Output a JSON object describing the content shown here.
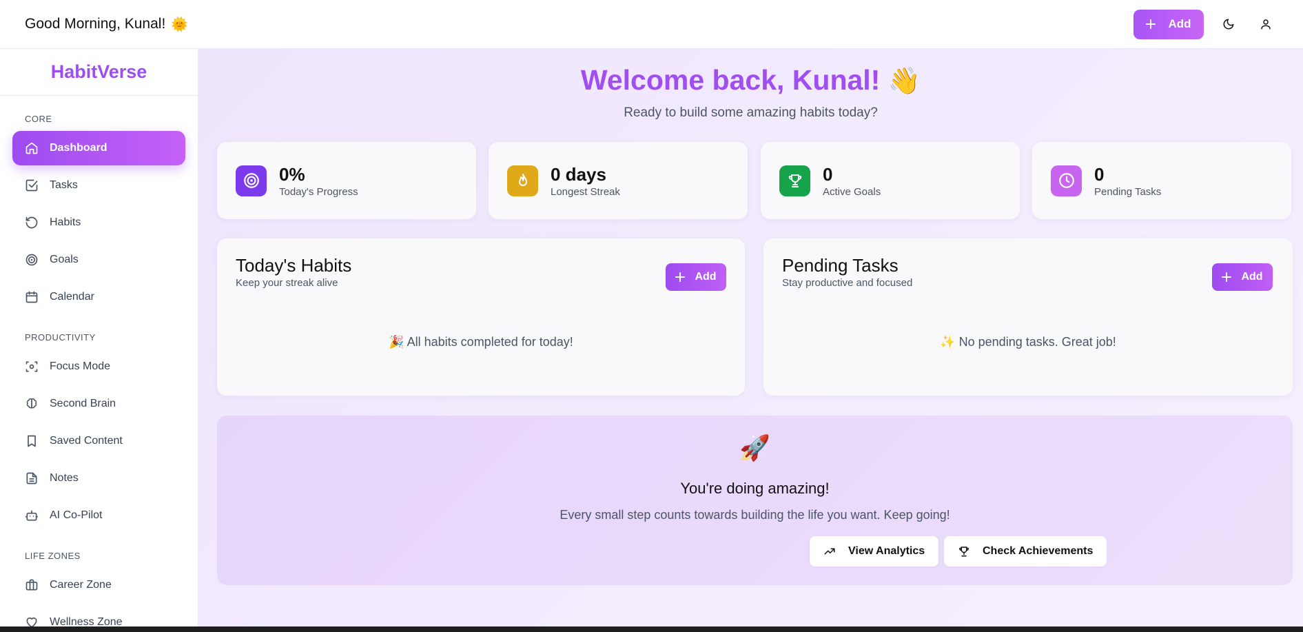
{
  "topbar": {
    "greeting": "Good Morning, Kunal!",
    "greeting_emoji": "🌞",
    "add_label": "Add",
    "theme_icon": "moon-icon",
    "profile_icon": "user-icon"
  },
  "sidebar": {
    "brand": "HabitVerse",
    "sections": {
      "core": "CORE",
      "productivity": "PRODUCTIVITY",
      "life_zones": "LIFE ZONES"
    },
    "core_items": [
      {
        "label": "Dashboard",
        "icon": "home-icon",
        "active": true
      },
      {
        "label": "Tasks",
        "icon": "checkbox-icon"
      },
      {
        "label": "Habits",
        "icon": "refresh-icon"
      },
      {
        "label": "Goals",
        "icon": "target-icon"
      },
      {
        "label": "Calendar",
        "icon": "calendar-icon"
      }
    ],
    "productivity_items": [
      {
        "label": "Focus Mode",
        "icon": "focus-icon"
      },
      {
        "label": "Second Brain",
        "icon": "brain-icon"
      },
      {
        "label": "Saved Content",
        "icon": "bookmark-icon"
      },
      {
        "label": "Notes",
        "icon": "file-text-icon"
      },
      {
        "label": "AI Co-Pilot",
        "icon": "bot-icon"
      }
    ],
    "life_zone_items": [
      {
        "label": "Career Zone",
        "icon": "briefcase-icon"
      },
      {
        "label": "Wellness Zone",
        "icon": "heart-icon"
      }
    ]
  },
  "main": {
    "welcome": "Welcome back, Kunal!",
    "welcome_emoji": "👋",
    "subtitle": "Ready to build some amazing habits today?",
    "stats": [
      {
        "value": "0%",
        "label": "Today's Progress",
        "icon": "target-icon",
        "color": "#7c3aed"
      },
      {
        "value": "0 days",
        "label": "Longest Streak",
        "icon": "flame-icon",
        "color": "#e0a91a"
      },
      {
        "value": "0",
        "label": "Active Goals",
        "icon": "trophy-icon",
        "color": "#16a34a"
      },
      {
        "value": "0",
        "label": "Pending Tasks",
        "icon": "clock-icon",
        "color": "#c865f0"
      }
    ],
    "habits_panel": {
      "title": "Today's Habits",
      "subtitle": "Keep your streak alive",
      "add_label": "Add",
      "empty_emoji": "🎉",
      "empty": "All habits completed for today!"
    },
    "tasks_panel": {
      "title": "Pending Tasks",
      "subtitle": "Stay productive and focused",
      "add_label": "Add",
      "empty_emoji": "✨",
      "empty": "No pending tasks. Great job!"
    },
    "banner": {
      "emoji": "🚀",
      "title": "You're doing amazing!",
      "text": "Every small step counts towards building the life you want. Keep going!",
      "analytics_label": "View Analytics",
      "achievements_label": "Check Achievements"
    }
  },
  "colors": {
    "accent": "#a855f7",
    "brand": "#9d4ef0",
    "background": "#efe5fd"
  }
}
